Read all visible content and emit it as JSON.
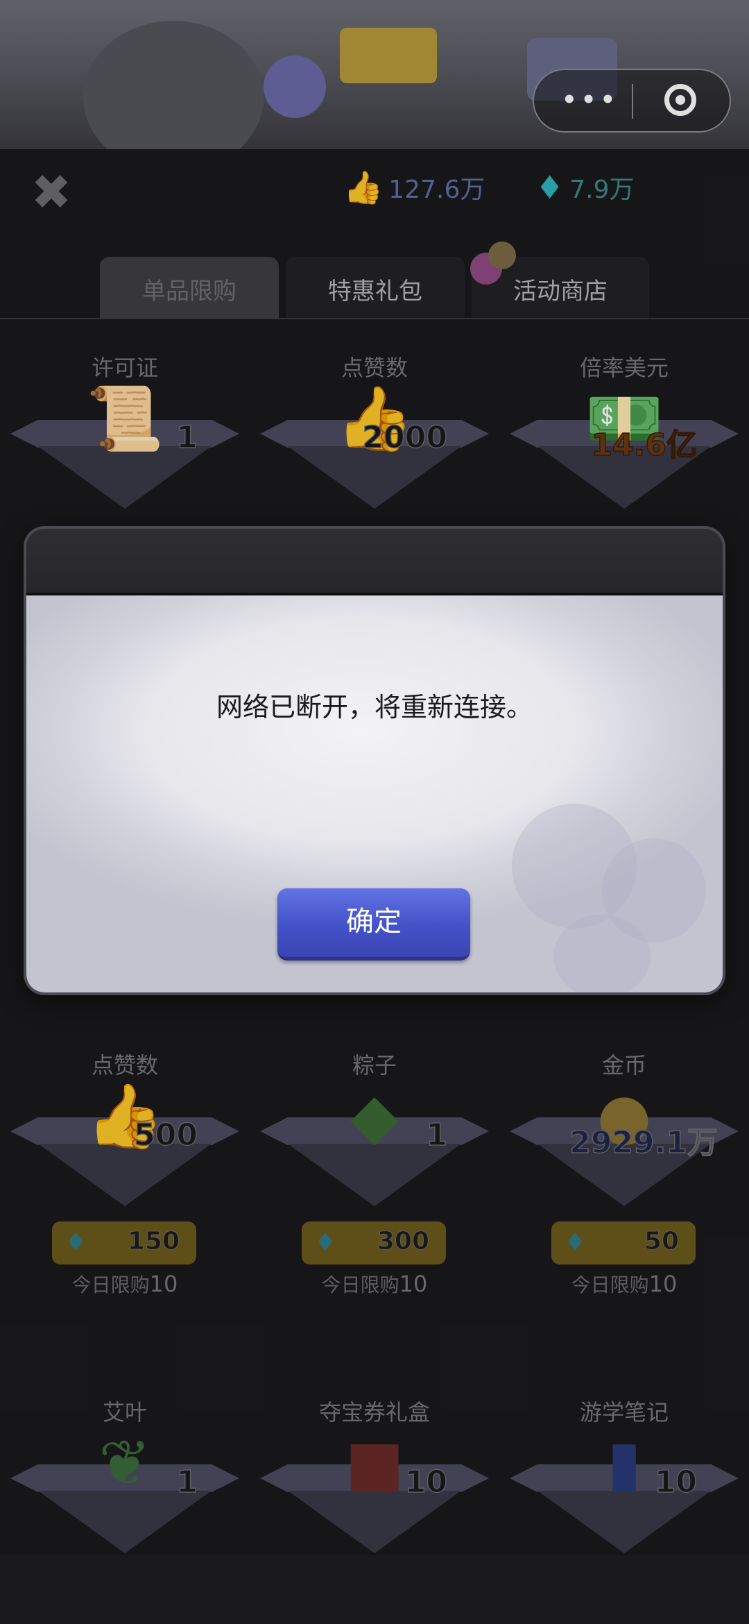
{
  "capsule": {
    "more_glyph": "•••",
    "more_icon": "more-dots-icon",
    "target_icon": "target-icon"
  },
  "header": {
    "likes": "127.6万",
    "gems": "7.9万",
    "likes_icon": "thumbs-up-icon",
    "gems_icon": "diamond-icon",
    "close_glyph": "✖"
  },
  "tabs": [
    {
      "label": "单品限购",
      "active": true
    },
    {
      "label": "特惠礼包",
      "active": false
    },
    {
      "label": "活动商店",
      "active": false
    }
  ],
  "items_row1": [
    {
      "name": "许可证",
      "qty": "1",
      "icon": "scroll-icon"
    },
    {
      "name": "点赞数",
      "qty": "2000",
      "icon": "thumbs-up-icon"
    },
    {
      "name": "倍率美元",
      "qty": "14.6亿",
      "icon": "cash-icon"
    }
  ],
  "items_row2": [
    {
      "name": "点赞数",
      "qty": "500",
      "price": "150",
      "limit_label": "今日限购",
      "limit_count": "10",
      "icon": "thumbs-up-icon"
    },
    {
      "name": "粽子",
      "qty": "1",
      "price": "300",
      "limit_label": "今日限购",
      "limit_count": "10",
      "icon": "zongzi-icon"
    },
    {
      "name": "金币",
      "qty": "2929.1万",
      "price": "50",
      "limit_label": "今日限购",
      "limit_count": "10",
      "icon": "coins-icon"
    }
  ],
  "items_row3": [
    {
      "name": "艾叶",
      "qty": "1",
      "icon": "mugwort-leaf-icon"
    },
    {
      "name": "夺宝券礼盒",
      "qty": "10",
      "icon": "gift-box-icon"
    },
    {
      "name": "游学笔记",
      "qty": "10",
      "icon": "passport-icon"
    }
  ],
  "dialog": {
    "message": "网络已断开，将重新连接。",
    "confirm_label": "确定"
  },
  "colors": {
    "confirm_button": "#4a58d0",
    "dialog_body": "#e7e7ec",
    "background": "#1a1a1c"
  }
}
